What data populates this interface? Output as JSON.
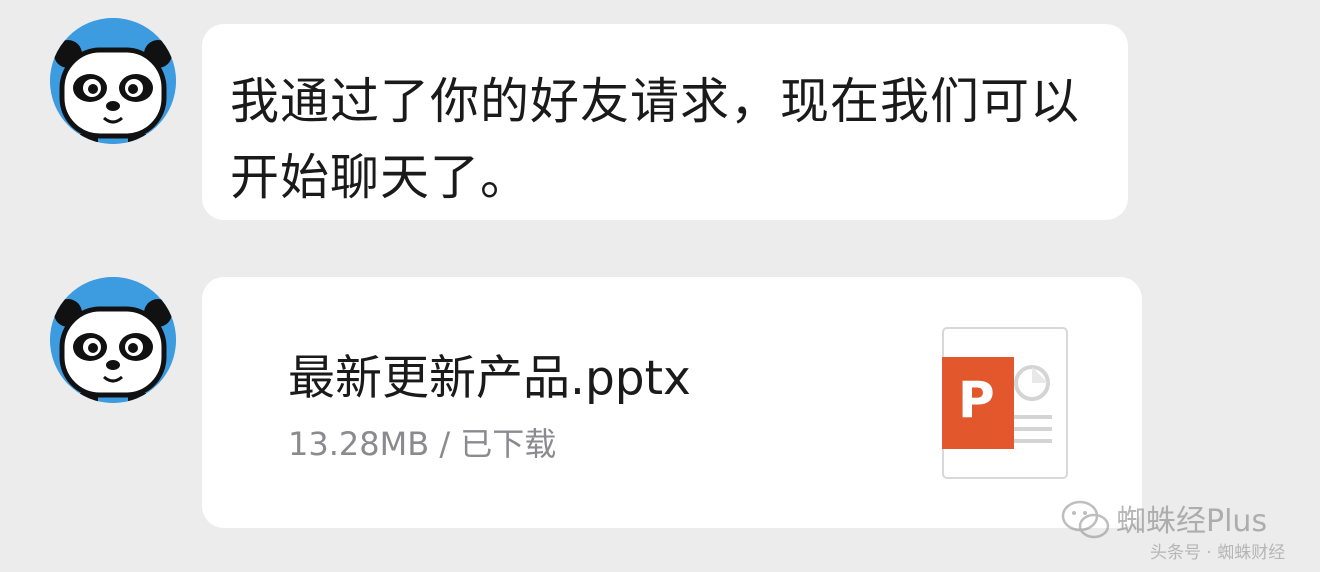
{
  "messages": [
    {
      "type": "text",
      "text": "我通过了你的好友请求，现在我们可以开始聊天了。"
    },
    {
      "type": "file",
      "file_name": "最新更新产品.pptx",
      "meta": "13.28MB / 已下载",
      "file_icon": "powerpoint-icon",
      "file_icon_letter": "P"
    }
  ],
  "avatar": {
    "icon": "panda-avatar-icon"
  },
  "watermark": {
    "main": "蜘蛛经Plus",
    "sub": "头条号 · 蜘蛛财经"
  },
  "colors": {
    "background": "#ececec",
    "bubble": "#ffffff",
    "avatar_bg": "#3d9be0",
    "ppt_orange": "#e2572b",
    "meta_text": "#8a8a8f"
  }
}
